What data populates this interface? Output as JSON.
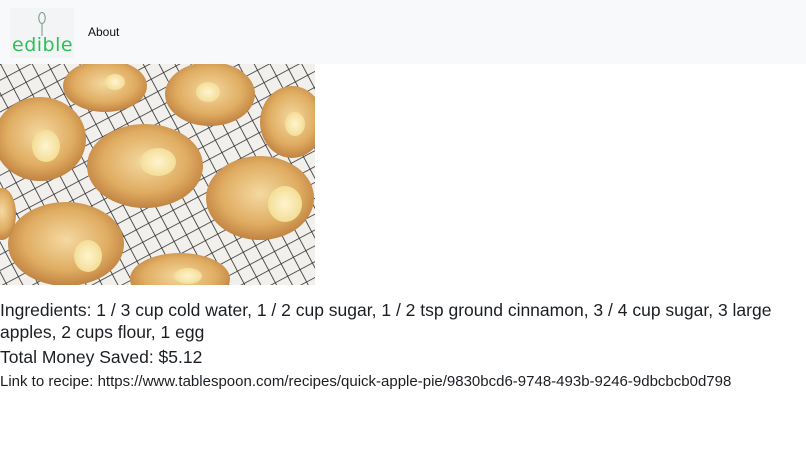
{
  "navbar": {
    "brand_label": "edible",
    "about_label": "About"
  },
  "recipe": {
    "image_alt": "Apple pastries cooling on a wire rack",
    "ingredients_text": "Ingredients: 1 / 3 cup cold water, 1 / 2 cup sugar, 1 / 2 tsp ground cinnamon, 3 / 4 cup sugar, 3 large apples, 2 cups flour, 1 egg",
    "savings_text": "Total Money Saved: $5.12",
    "link_label": "Link to recipe: ",
    "link_url": "https://www.tablespoon.com/recipes/quick-apple-pie/9830bcd6-9748-493b-9246-9dbcbcb0d798"
  },
  "colors": {
    "brand_green": "#2fbf5a",
    "navbar_bg": "#f8f9fa"
  }
}
